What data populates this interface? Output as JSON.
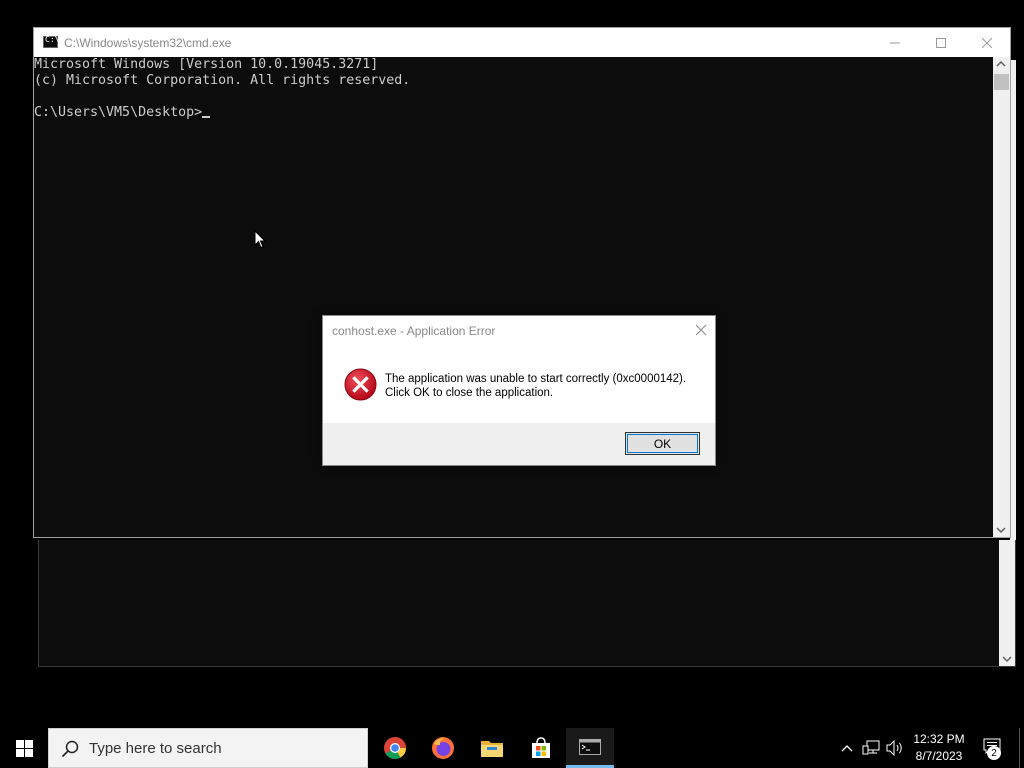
{
  "cmd_window": {
    "title": "C:\\Windows\\system32\\cmd.exe",
    "icon_text": "C:\\",
    "lines": [
      "Microsoft Windows [Version 10.0.19045.3271]",
      "(c) Microsoft Corporation. All rights reserved.",
      "",
      "C:\\Users\\VM5\\Desktop>"
    ]
  },
  "dialog": {
    "title": "conhost.exe - Application Error",
    "message_line1": "The application was unable to start correctly (0xc0000142).",
    "message_line2": "Click OK to close the application.",
    "ok_label": "OK",
    "icon": "error-x-icon"
  },
  "taskbar": {
    "search_placeholder": "Type here to search",
    "apps": [
      "chrome-icon",
      "firefox-icon",
      "file-explorer-icon",
      "microsoft-store-icon",
      "cmd-icon"
    ],
    "clock_time": "12:32 PM",
    "clock_date": "8/7/2023",
    "notification_count": "2"
  },
  "colors": {
    "console_bg": "#0c0c0c",
    "console_text": "#cccccc",
    "error_red": "#d0021b",
    "accent": "#0078d7"
  }
}
